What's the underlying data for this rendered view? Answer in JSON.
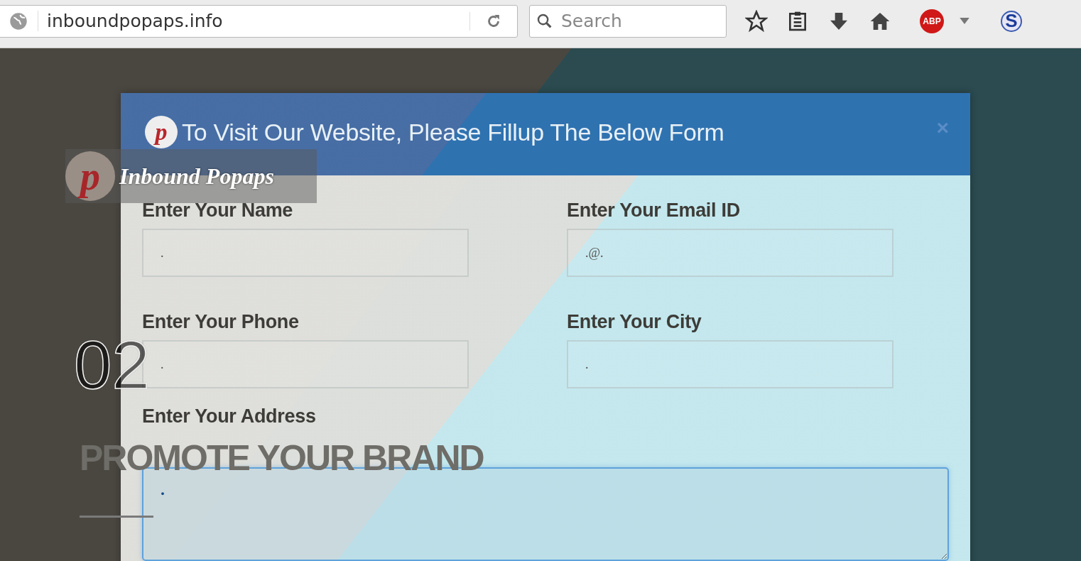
{
  "browser": {
    "address": "inboundpopaps.info",
    "search": {
      "placeholder": "Search"
    },
    "badges": [
      {
        "kind": "abp",
        "text": "ABP"
      },
      {
        "kind": "sync",
        "text": "S"
      }
    ]
  },
  "background": {
    "logo_letter": "p",
    "logo": "Inbound Popaps",
    "slide_number": "02",
    "headline": "PROMOTE YOUR BRAND"
  },
  "modal": {
    "title": "To Visit Our Website, Please Fillup The Below Form",
    "logo_letter": "p",
    "close": "×",
    "fields": [
      {
        "label": "Enter Your Name",
        "value": ".",
        "kind": "input",
        "focused": false
      },
      {
        "label": "Enter Your Email ID",
        "value": ".@.",
        "kind": "input",
        "focused": false
      },
      {
        "label": "Enter Your Phone",
        "value": ".",
        "kind": "input",
        "focused": false
      },
      {
        "label": "Enter Your City",
        "value": ".",
        "kind": "input",
        "focused": false
      },
      {
        "label": "Enter Your Address",
        "value": ".",
        "kind": "textarea",
        "focused": true
      }
    ]
  }
}
